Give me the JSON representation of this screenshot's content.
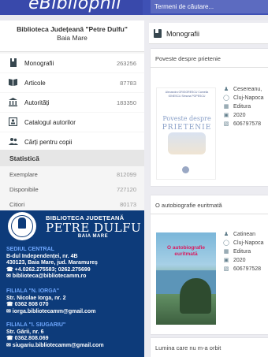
{
  "header": {
    "logo_text": "eBibliophil",
    "search_placeholder": "Termeni de căutare..."
  },
  "library": {
    "name": "Biblioteca Județeană \"Petre Dulfu\"",
    "city": "Baia Mare"
  },
  "nav": {
    "items": [
      {
        "label": "Monografii",
        "count": "263256",
        "icon": "book-icon"
      },
      {
        "label": "Articole",
        "count": "87783",
        "icon": "open-book-icon"
      },
      {
        "label": "Autorități",
        "count": "183350",
        "icon": "institution-icon"
      },
      {
        "label": "Catalogul autorilor",
        "count": "",
        "icon": "id-card-icon"
      },
      {
        "label": "Cărți pentru copii",
        "count": "",
        "icon": "people-icon"
      }
    ]
  },
  "stats": {
    "title": "Statistică",
    "rows": [
      {
        "label": "Exemplare",
        "value": "812099"
      },
      {
        "label": "Disponibile",
        "value": "727120"
      },
      {
        "label": "Citiori",
        "value": "80173"
      }
    ]
  },
  "banner": {
    "line1": "BIBLIOTECA JUDEȚEANĂ",
    "line2": "PETRE DULFU",
    "line3": "BAIA MARE",
    "sections": [
      {
        "title": "SEDIUL CENTRAL",
        "lines": [
          "B-dul Independenței, nr. 4B",
          "430123, Baia Mare, jud. Maramureș",
          "☎ +4.0262.275583; 0262.275699",
          "✉ biblioteca@bibliotecamm.ro"
        ]
      },
      {
        "title": "FILIALA \"N. IORGA\"",
        "lines": [
          "Str. Nicolae Iorga, nr. 2",
          "☎ 0362 808 070",
          "✉ iorga.bibliotecamm@gmail.com"
        ]
      },
      {
        "title": "FILIALA \"I. SIUGARIU\"",
        "lines": [
          "Str. Gării, nr. 6",
          "☎ 0362.808.069",
          "✉ siugariu.bibliotecamm@gmail.com"
        ]
      }
    ]
  },
  "main": {
    "section_title": "Monografii",
    "cards": [
      {
        "title": "Poveste despre prietenie",
        "cover_authors": "Alexandra GRIGORESCU   Camelia IONESCU   Simona POPESCU",
        "cover_title_1": "Poveste despre",
        "cover_title_2": "PRIETENIE",
        "meta": [
          {
            "icon": "person-icon",
            "text": "Cesereanu,"
          },
          {
            "icon": "globe-icon",
            "text": "Cluj-Napoca"
          },
          {
            "icon": "building-icon",
            "text": "Editura"
          },
          {
            "icon": "calendar-icon",
            "text": "2020"
          },
          {
            "icon": "isbn-icon",
            "text": "606797578"
          }
        ]
      },
      {
        "title": "O autobiografie euritmată",
        "cover_title_1": "O autobiografie",
        "cover_title_2": "euritmată",
        "meta": [
          {
            "icon": "person-icon",
            "text": "Catinean"
          },
          {
            "icon": "globe-icon",
            "text": "Cluj-Napoca"
          },
          {
            "icon": "building-icon",
            "text": "Editura"
          },
          {
            "icon": "calendar-icon",
            "text": "2020"
          },
          {
            "icon": "isbn-icon",
            "text": "606797528"
          }
        ]
      },
      {
        "title": "Lumina care nu m-a orbit"
      }
    ]
  }
}
